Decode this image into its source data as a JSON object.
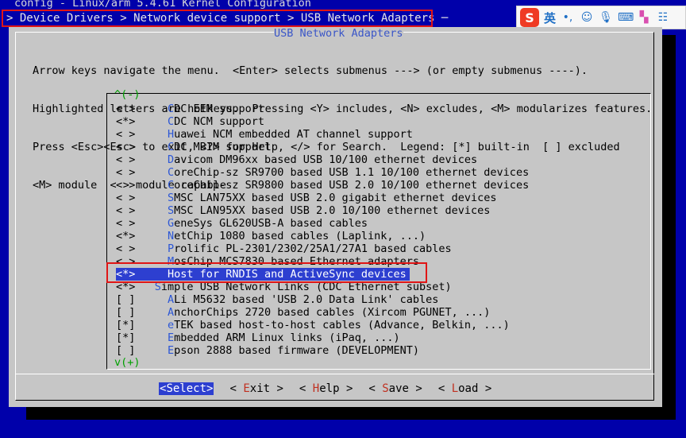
{
  "window": {
    "title": "config - Linux/arm 5.4.61 Kernel Configuration",
    "breadcrumb": "> Device Drivers > Network device support > USB Network Adapters ─"
  },
  "ime": {
    "logo": "S",
    "mode": "英",
    "icons": [
      "punctuation-icon",
      "emoji-icon",
      "microphone-icon",
      "keyboard-icon",
      "skin-icon",
      "menu-icon"
    ]
  },
  "dialog": {
    "title": "USB Network Adapters",
    "help_lines": [
      "Arrow keys navigate the menu.  <Enter> selects submenus ---> (or empty submenus ----).",
      "Highlighted letters are hotkeys.  Pressing <Y> includes, <N> excludes, <M> modularizes features.",
      "Press <Esc><Esc> to exit, <?> for Help, </> for Search.  Legend: [*] built-in  [ ] excluded",
      "<M> module  < > module capable"
    ],
    "scroll_up": "^(-)",
    "scroll_down": "v(+)"
  },
  "items": [
    {
      "state": "< >",
      "hot": "C",
      "rest": "DC EEM support",
      "indent": 1
    },
    {
      "state": "<*>",
      "hot": "C",
      "rest": "DC NCM support",
      "indent": 1
    },
    {
      "state": "< >",
      "hot": "H",
      "rest": "uawei NCM embedded AT channel support",
      "indent": 1
    },
    {
      "state": "< >",
      "hot": "C",
      "rest": "DC MBIM support",
      "indent": 1
    },
    {
      "state": "< >",
      "hot": "D",
      "rest": "avicom DM96xx based USB 10/100 ethernet devices",
      "indent": 1
    },
    {
      "state": "< >",
      "hot": "C",
      "rest": "oreChip-sz SR9700 based USB 1.1 10/100 ethernet devices",
      "indent": 1
    },
    {
      "state": "< >",
      "hot": "C",
      "rest": "oreChip-sz SR9800 based USB 2.0 10/100 ethernet devices",
      "indent": 1
    },
    {
      "state": "< >",
      "hot": "S",
      "rest": "MSC LAN75XX based USB 2.0 gigabit ethernet devices",
      "indent": 1
    },
    {
      "state": "< >",
      "hot": "S",
      "rest": "MSC LAN95XX based USB 2.0 10/100 ethernet devices",
      "indent": 1
    },
    {
      "state": "< >",
      "hot": "G",
      "rest": "eneSys GL620USB-A based cables",
      "indent": 1
    },
    {
      "state": "<*>",
      "hot": "N",
      "rest": "etChip 1080 based cables (Laplink, ...)",
      "indent": 1
    },
    {
      "state": "< >",
      "hot": "P",
      "rest": "rolific PL-2301/2302/25A1/27A1 based cables",
      "indent": 1
    },
    {
      "state": "< >",
      "hot": "M",
      "rest": "osChip MCS7830 based Ethernet adapters",
      "indent": 1
    },
    {
      "state": "<*>",
      "hot": "H",
      "rest": "ost for RNDIS and ActiveSync devices",
      "indent": 1,
      "selected": true
    },
    {
      "state": "<*>",
      "hot": "S",
      "rest": "imple USB Network Links (CDC Ethernet subset)",
      "indent": 0
    },
    {
      "state": "[ ]",
      "hot": "A",
      "rest": "Li M5632 based 'USB 2.0 Data Link' cables",
      "indent": 1
    },
    {
      "state": "[ ]",
      "hot": "A",
      "rest": "nchorChips 2720 based cables (Xircom PGUNET, ...)",
      "indent": 1
    },
    {
      "state": "[*]",
      "hot": "e",
      "rest": "TEK based host-to-host cables (Advance, Belkin, ...)",
      "indent": 1
    },
    {
      "state": "[*]",
      "hot": "E",
      "rest": "mbedded ARM Linux links (iPaq, ...)",
      "indent": 1
    },
    {
      "state": "[ ]",
      "hot": "E",
      "rest": "pson 2888 based firmware (DEVELOPMENT)",
      "indent": 1
    }
  ],
  "buttons": [
    {
      "hot": "S",
      "rest": "elect",
      "active": true
    },
    {
      "hot": "E",
      "rest": "xit",
      "active": false
    },
    {
      "hot": "H",
      "rest": "elp",
      "active": false
    },
    {
      "hot": "S",
      "rest": "ave",
      "active": false
    },
    {
      "hot": "L",
      "rest": "oad",
      "active": false
    }
  ]
}
